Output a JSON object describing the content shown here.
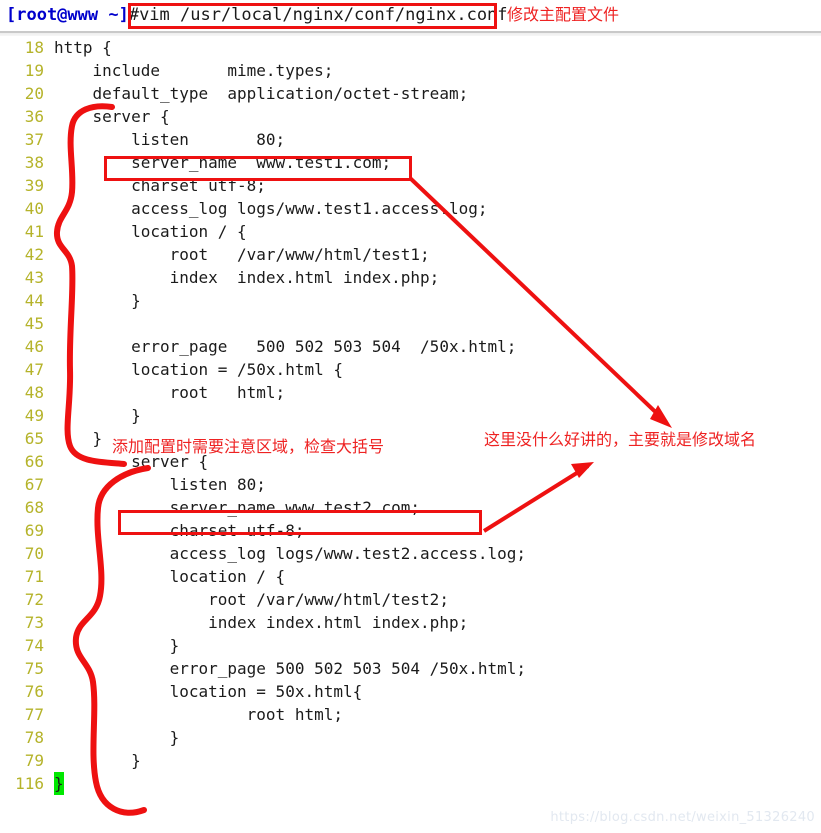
{
  "terminal": {
    "prompt_user": "[root@www ~]",
    "prompt_command": "#vim /usr/local/nginx/conf/nginx.conf",
    "prompt_note": "修改主配置文件"
  },
  "colors": {
    "annotation_red": "#ee1111",
    "note_red": "#ee2222",
    "lineno_olive": "#b5b32a",
    "prompt_blue": "#0000cc",
    "highlight_green": "#00e800",
    "code_black": "#1b1b1b"
  },
  "editor": {
    "filename": "/usr/local/nginx/conf/nginx.conf",
    "lines": [
      {
        "no": "18",
        "text": "http {"
      },
      {
        "no": "19",
        "text": "    include       mime.types;"
      },
      {
        "no": "20",
        "text": "    default_type  application/octet-stream;"
      },
      {
        "no": "36",
        "text": "    server {"
      },
      {
        "no": "37",
        "text": "        listen       80;"
      },
      {
        "no": "38",
        "text": "        server_name  www.test1.com;"
      },
      {
        "no": "39",
        "text": "        charset utf-8;"
      },
      {
        "no": "40",
        "text": "        access_log logs/www.test1.access.log;"
      },
      {
        "no": "41",
        "text": "        location / {"
      },
      {
        "no": "42",
        "text": "            root   /var/www/html/test1;"
      },
      {
        "no": "43",
        "text": "            index  index.html index.php;"
      },
      {
        "no": "44",
        "text": "        }"
      },
      {
        "no": "45",
        "text": ""
      },
      {
        "no": "46",
        "text": "        error_page   500 502 503 504  /50x.html;"
      },
      {
        "no": "47",
        "text": "        location = /50x.html {"
      },
      {
        "no": "48",
        "text": "            root   html;"
      },
      {
        "no": "49",
        "text": "        }"
      },
      {
        "no": "65",
        "text": "    }"
      },
      {
        "no": "66",
        "text": "        server {"
      },
      {
        "no": "67",
        "text": "            listen 80;"
      },
      {
        "no": "68",
        "text": "            server_name www.test2.com;"
      },
      {
        "no": "69",
        "text": "            charset utf-8;"
      },
      {
        "no": "70",
        "text": "            access_log logs/www.test2.access.log;"
      },
      {
        "no": "71",
        "text": "            location / {"
      },
      {
        "no": "72",
        "text": "                root /var/www/html/test2;"
      },
      {
        "no": "73",
        "text": "                index index.html index.php;"
      },
      {
        "no": "74",
        "text": "            }"
      },
      {
        "no": "75",
        "text": "            error_page 500 502 503 504 /50x.html;"
      },
      {
        "no": "76",
        "text": "            location = 50x.html{"
      },
      {
        "no": "77",
        "text": "                    root html;"
      },
      {
        "no": "78",
        "text": "            }"
      },
      {
        "no": "79",
        "text": "        }"
      },
      {
        "no": "116",
        "text": "}",
        "highlight": true
      }
    ]
  },
  "annotations": {
    "note_braces": "添加配置时需要注意区域，检查大括号",
    "note_domain": "这里没什么好讲的，主要就是修改域名",
    "box_command_label": "vim command highlight box",
    "box_server_name_1_label": "server_name www.test1.com highlight box",
    "box_server_name_2_label": "server_name www.test2.com highlight box"
  },
  "watermark": {
    "text": "https://blog.csdn.net/weixin_51326240"
  }
}
